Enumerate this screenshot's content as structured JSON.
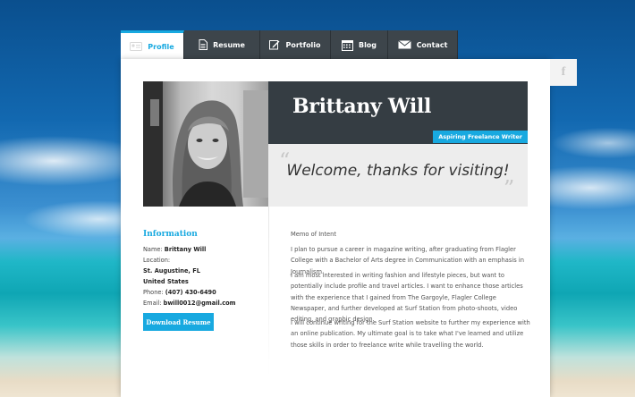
{
  "tabs": [
    {
      "label": "Profile",
      "icon": "id-card-icon",
      "active": true
    },
    {
      "label": "Resume",
      "icon": "document-icon"
    },
    {
      "label": "Portfolio",
      "icon": "pencil-icon"
    },
    {
      "label": "Blog",
      "icon": "calendar-icon"
    },
    {
      "label": "Contact",
      "icon": "envelope-icon"
    }
  ],
  "social": {
    "icon": "facebook-icon",
    "label": "f"
  },
  "header": {
    "name": "Brittany Will",
    "role": "Aspiring Freelance Writer",
    "welcome": "Welcome, thanks for visiting!",
    "quote_open": "“",
    "quote_close": "”"
  },
  "info": {
    "heading": "Information",
    "name_label": "Name:",
    "name": "Brittany Will",
    "location_label": "Location:",
    "city": "St. Augustine, FL",
    "country": "United States",
    "phone_label": "Phone:",
    "phone": "(407) 430-6490",
    "email_label": "Email:",
    "email": "bwill0012@gmail.com",
    "download_label": "Download Resume"
  },
  "memo": {
    "title": "Memo of Intent",
    "p1": "I plan to pursue a career in magazine writing, after graduating from Flagler College with a Bachelor of Arts degree in Communication with an emphasis in Journalism.",
    "p2": "I am most interested in writing fashion and lifestyle pieces, but want to potentially include profile and travel articles. I want to enhance those articles with the experience that I gained from The Gargoyle, Flagler College Newspaper, and further developed at Surf Station from photo-shoots, video editing, and graphic design.",
    "p3": "I will continue writing for the Surf Station website to further my experience with an online publication. My ultimate goal is to take what I've learned and utilize those skills in order to freelance write while travelling the world."
  },
  "colors": {
    "accent": "#18a9e0",
    "dark": "#353d43",
    "tab_bg": "#3d454b"
  }
}
